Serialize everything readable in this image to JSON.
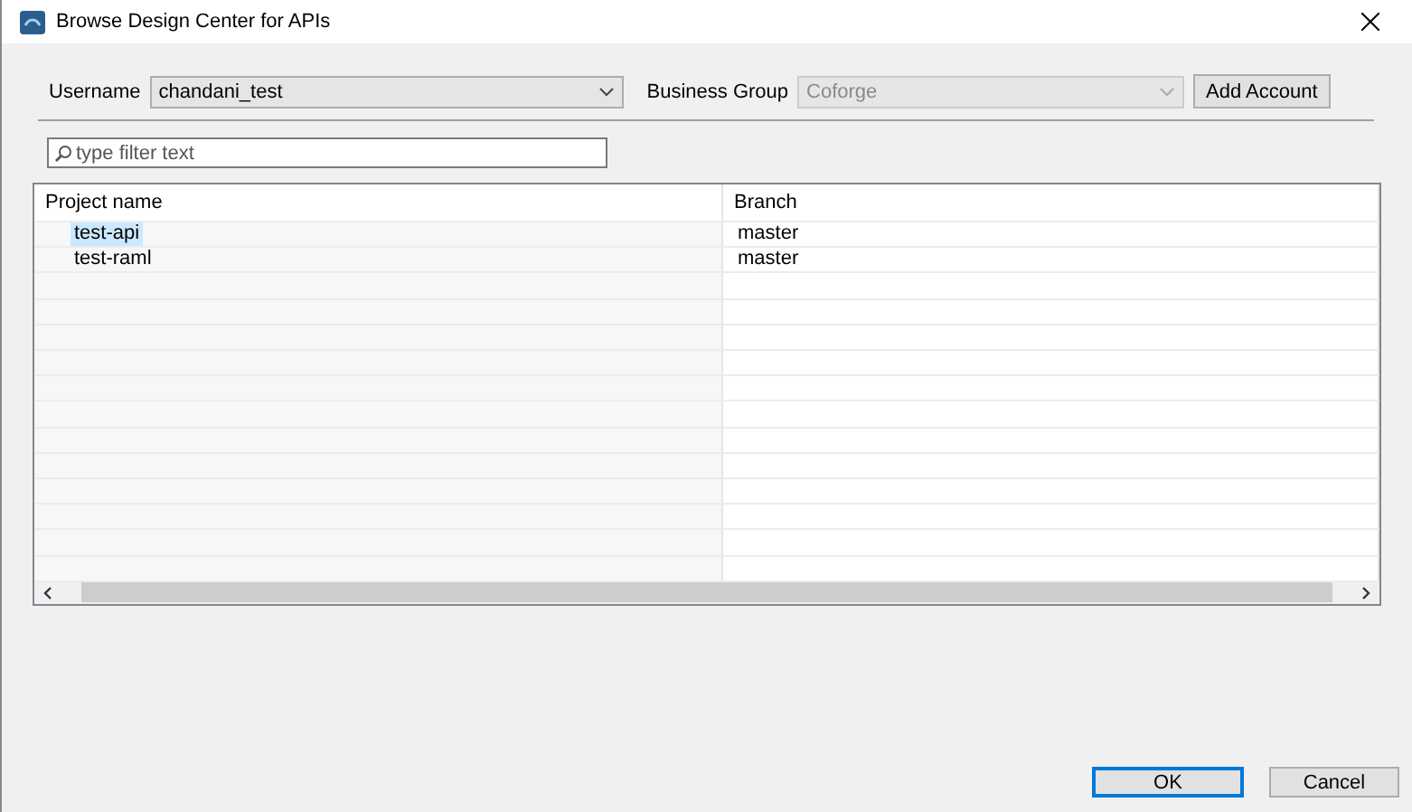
{
  "window": {
    "title": "Browse Design Center for APIs"
  },
  "username": {
    "label": "Username",
    "value": "chandani_test"
  },
  "business_group": {
    "label": "Business Group",
    "value": "Coforge",
    "disabled": true
  },
  "add_account": "Add Account",
  "filter": {
    "placeholder": "type filter text"
  },
  "table": {
    "columns": [
      "Project name",
      "Branch"
    ],
    "rows": [
      {
        "name": "test-api",
        "branch": "master",
        "selected": true
      },
      {
        "name": "test-raml",
        "branch": "master",
        "selected": false
      }
    ]
  },
  "buttons": [
    {
      "label": "OK",
      "default": true
    },
    {
      "label": "Cancel",
      "default": false
    }
  ]
}
